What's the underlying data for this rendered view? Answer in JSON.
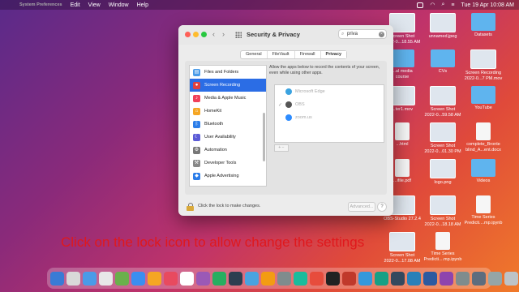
{
  "menubar": {
    "app_name": "System Preferences",
    "menus": [
      "Edit",
      "View",
      "Window",
      "Help"
    ],
    "datetime": "Tue 19 Apr  10:08 AM"
  },
  "window": {
    "title": "Security & Privacy",
    "search_value": "priva",
    "tabs": [
      "General",
      "FileVault",
      "Firewall",
      "Privacy"
    ],
    "active_tab": "Privacy",
    "sidebar": [
      {
        "label": "Files and Folders",
        "icon": "folder-icon",
        "color": "#4a9be8"
      },
      {
        "label": "Screen Recording",
        "icon": "screen-recording-icon",
        "color": "#e04040",
        "selected": true
      },
      {
        "label": "Media & Apple Music",
        "icon": "music-icon",
        "color": "#f0405a"
      },
      {
        "label": "HomeKit",
        "icon": "home-icon",
        "color": "#f5a623"
      },
      {
        "label": "Bluetooth",
        "icon": "bluetooth-icon",
        "color": "#2b7de9"
      },
      {
        "label": "User Availability",
        "icon": "moon-icon",
        "color": "#5b5bd6"
      },
      {
        "label": "Automation",
        "icon": "gear-icon",
        "color": "#777777"
      },
      {
        "label": "Developer Tools",
        "icon": "tools-icon",
        "color": "#888888"
      },
      {
        "label": "Apple Advertising",
        "icon": "megaphone-icon",
        "color": "#2b7de9"
      }
    ],
    "panel_desc": "Allow the apps below to record the contents of your screen, even while using other apps.",
    "apps": [
      {
        "name": "Microsoft Edge",
        "checked": false,
        "color": "#3ba3e0"
      },
      {
        "name": "OBS",
        "checked": true,
        "color": "#555555"
      },
      {
        "name": "zoom.us",
        "checked": false,
        "color": "#2d8cff"
      }
    ],
    "plus_minus": "+ −",
    "lock_text": "Click the lock to make changes.",
    "advanced_label": "Advanced...",
    "help_label": "?"
  },
  "desktop_icons": [
    {
      "label": "Screen Shot\n2022-0...18.55 AM",
      "kind": "shot"
    },
    {
      "label": "unnamed.jpeg",
      "kind": "shot"
    },
    {
      "label": "Datasets",
      "kind": "folder"
    },
    {
      "label": "...al media\ncourse",
      "kind": "folder"
    },
    {
      "label": "CVs",
      "kind": "folder"
    },
    {
      "label": "Screen Recording\n2022-0...7 PM.mov",
      "kind": "shot"
    },
    {
      "label": "...ter1.mov",
      "kind": "shot"
    },
    {
      "label": "Screen Shot\n2022-0...59.58 AM",
      "kind": "shot"
    },
    {
      "label": "YouTube",
      "kind": "folder"
    },
    {
      "label": "...html",
      "kind": "doc"
    },
    {
      "label": "Screen Shot\n2022-0...01.30 PM",
      "kind": "shot"
    },
    {
      "label": "complete_Bronte\nblind_A...ent.docx",
      "kind": "doc"
    },
    {
      "label": "...ifile.pdf",
      "kind": "doc"
    },
    {
      "label": "logo.png",
      "kind": "shot"
    },
    {
      "label": "Videos",
      "kind": "folder"
    },
    {
      "label": "OBS-Studio 27.2.4",
      "kind": "shot"
    },
    {
      "label": "Screen Shot\n2022-0...18.18 AM",
      "kind": "shot"
    },
    {
      "label": "Time Series\nPredicti....mp.ipynb",
      "kind": "doc"
    },
    {
      "label": "Screen Shot\n2022-0...17.08 AM",
      "kind": "shot"
    },
    {
      "label": "Time Series\nPredicti....mp.ipynb",
      "kind": "doc"
    }
  ],
  "caption": "Click on the lock icon to allow change the settings",
  "dock_colors": [
    "#3a7bd5",
    "#d9d9d9",
    "#4a9be8",
    "#e8e8e8",
    "#6ab04c",
    "#3a8ef0",
    "#f5a623",
    "#e84a5f",
    "#ffffff",
    "#9b59b6",
    "#27ae60",
    "#2c3e50",
    "#4aa3df",
    "#f39c12",
    "#7f8c8d",
    "#1abc9c",
    "#e74c3c",
    "#222222",
    "#c0392b",
    "#3498db",
    "#16a085",
    "#34495e",
    "#2980b9",
    "#2c5aa0",
    "#8e44ad",
    "#7f8c8d",
    "#5d6d7e",
    "#95a5a6",
    "#bdc3c7",
    "#aab7b8"
  ]
}
